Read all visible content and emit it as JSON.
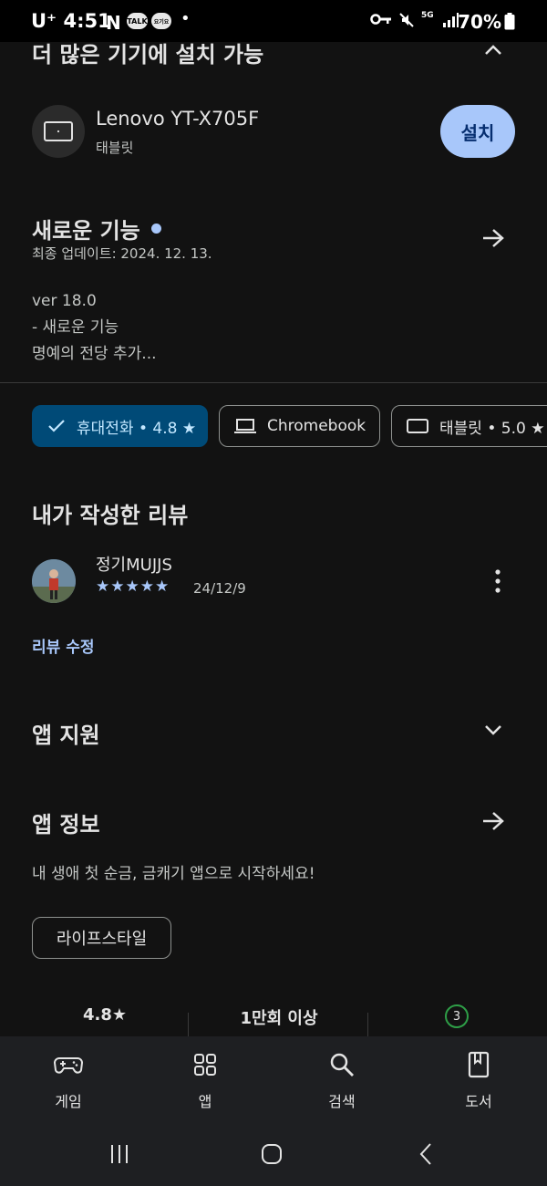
{
  "status_bar": {
    "carrier": "U⁺",
    "time": "4:51",
    "notif_icons": [
      "N",
      "TALK",
      "요기요"
    ],
    "dot": "•",
    "network": "5G",
    "battery": "70%"
  },
  "devices_section": {
    "title": "더 많은 기기에 설치 가능",
    "device_name": "Lenovo YT-X705F",
    "device_type": "태블릿",
    "install_label": "설치"
  },
  "whats_new": {
    "title": "새로운 기능",
    "updated": "최종 업데이트: 2024. 12. 13.",
    "lines": [
      "ver 18.0",
      "- 새로운 기능",
      "명예의 전당 추가..."
    ]
  },
  "chips": [
    {
      "label": "휴대전화 • 4.8 ★",
      "icon": "check-icon",
      "selected": true
    },
    {
      "label": "Chromebook",
      "icon": "laptop-icon",
      "selected": false
    },
    {
      "label": "태블릿 • 5.0 ★",
      "icon": "tablet-icon",
      "selected": false
    }
  ],
  "my_review": {
    "title": "내가 작성한 리뷰",
    "username": "정기MUJJS",
    "stars": "★★★★★",
    "rating_value": 5,
    "date": "24/12/9",
    "edit_label": "리뷰 수정"
  },
  "app_support": {
    "title": "앱 지원"
  },
  "app_info": {
    "title": "앱 정보",
    "description": "내 생애 첫 순금, 금캐기 앱으로 시작하세요!",
    "tag": "라이프스타일"
  },
  "stats": {
    "rating": "4.8★",
    "downloads": "1만회 이상",
    "age_badge": "3"
  },
  "bottom_nav": [
    {
      "label": "게임",
      "icon": "gamepad-icon"
    },
    {
      "label": "앱",
      "icon": "apps-grid-icon"
    },
    {
      "label": "검색",
      "icon": "search-icon"
    },
    {
      "label": "도서",
      "icon": "book-icon"
    }
  ],
  "colors": {
    "accent": "#a8c7fa",
    "selected_chip": "#004a77",
    "background": "#121212"
  }
}
